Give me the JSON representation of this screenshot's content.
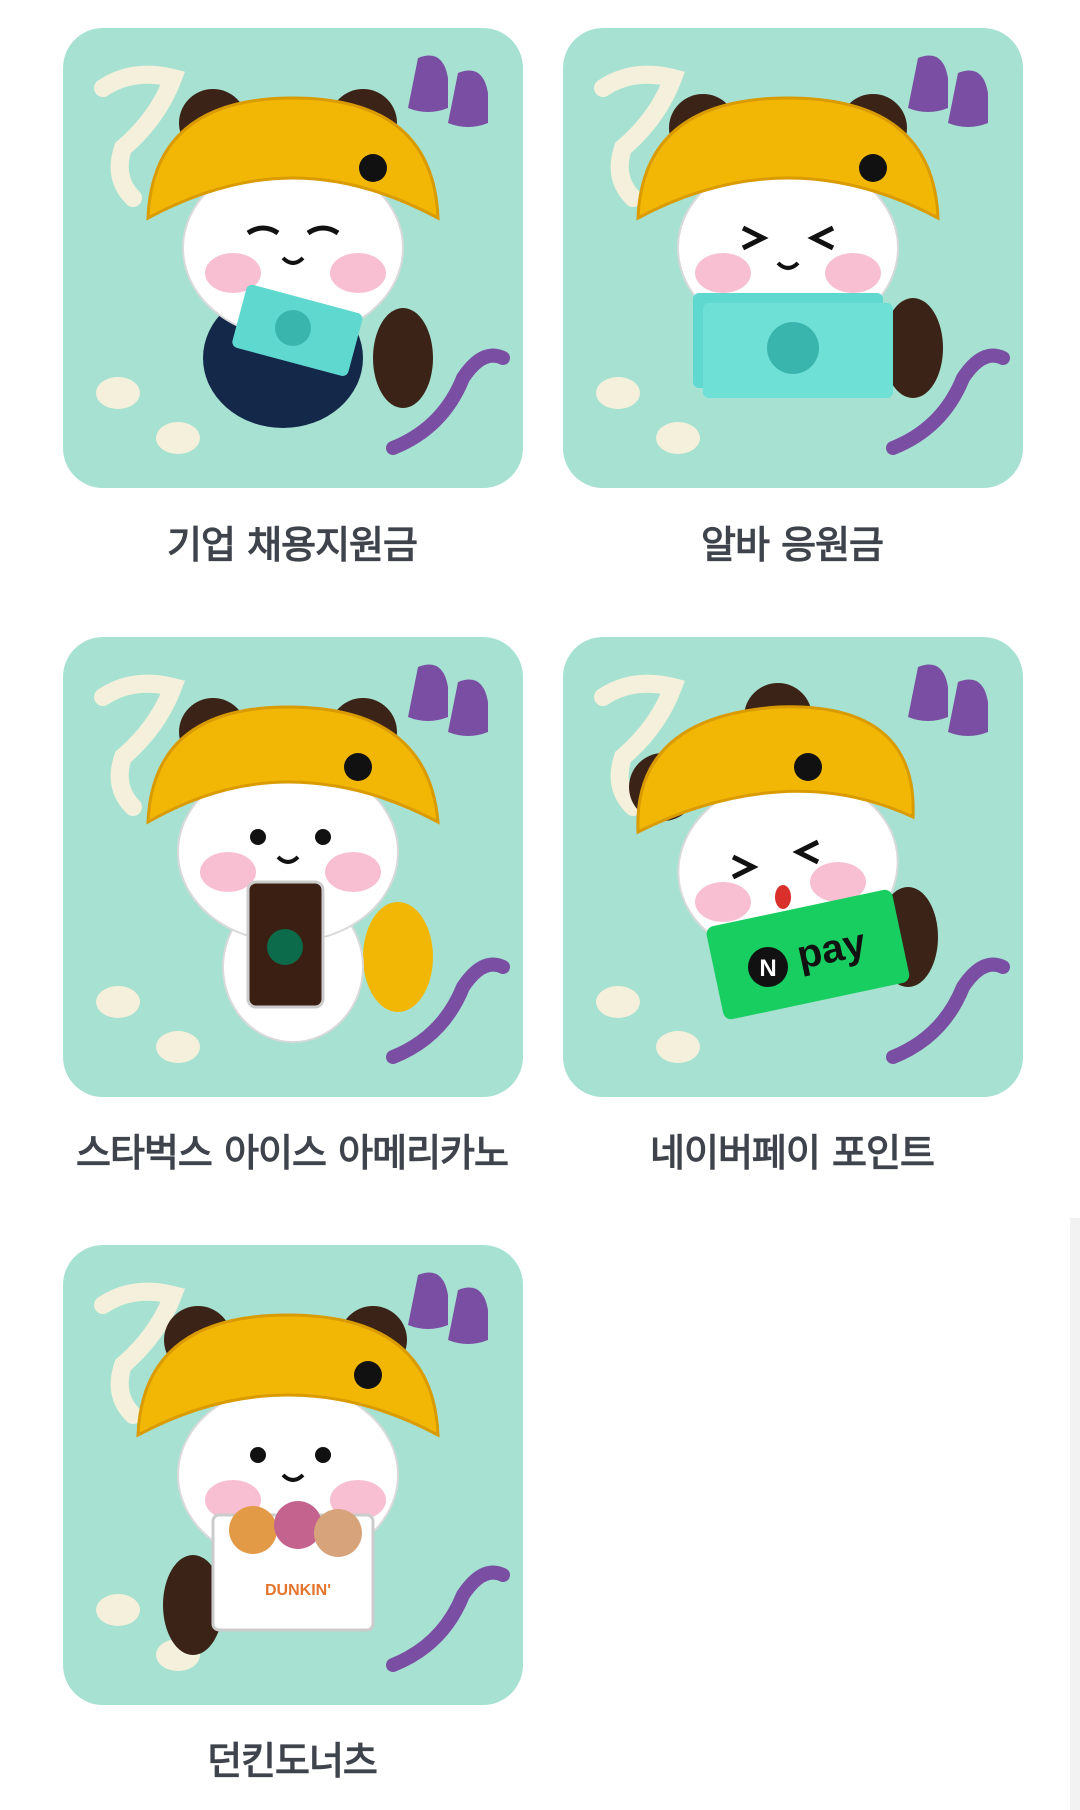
{
  "rewards": [
    {
      "label": "기업 채용지원금",
      "item": "money",
      "expression": "smile"
    },
    {
      "label": "알바 응원금",
      "item": "money",
      "expression": "squint"
    },
    {
      "label": "스타벅스 아이스 아메리카노",
      "item": "coffee",
      "expression": "open"
    },
    {
      "label": "네이버페이 포인트",
      "item": "npay",
      "expression": "wink"
    },
    {
      "label": "던킨도너츠",
      "item": "donut",
      "expression": "open"
    }
  ],
  "npay_text": {
    "n": "N",
    "pay": "pay"
  },
  "brand_text": "DUNKIN'",
  "colors": {
    "card_bg": "#a6e1d1",
    "hat": "#f2b705",
    "label": "#3f444c",
    "npay_green": "#19ce60",
    "money": "#5fd8cf"
  }
}
